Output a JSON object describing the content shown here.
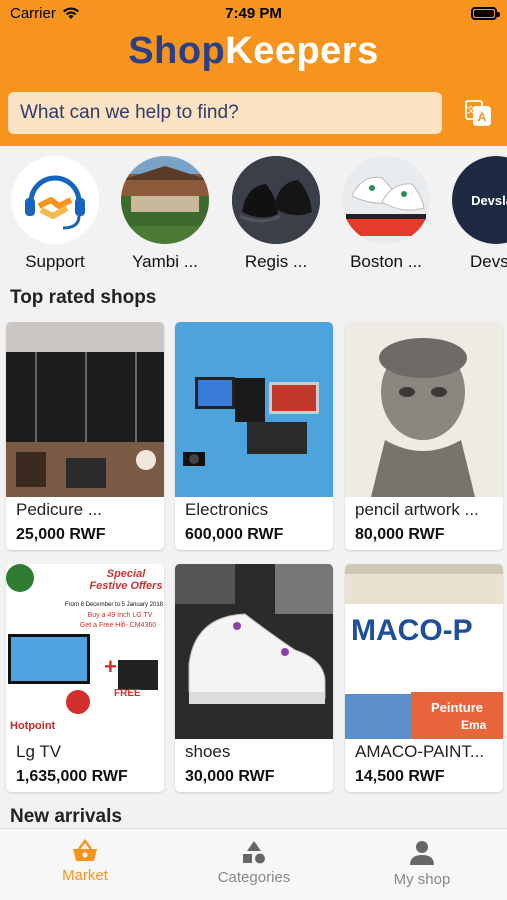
{
  "status": {
    "carrier": "Carrier",
    "time": "7:49 PM"
  },
  "brand": {
    "part1": "Shop",
    "part2": "Keepers"
  },
  "search": {
    "placeholder": "What can we help to find?"
  },
  "stories": [
    {
      "label": "Support"
    },
    {
      "label": "Yambi ..."
    },
    {
      "label": "Regis ..."
    },
    {
      "label": "Boston ..."
    },
    {
      "label": "Devsla"
    }
  ],
  "sections": {
    "top_rated": "Top rated shops",
    "new_arrivals": "New arrivals"
  },
  "products": [
    {
      "name": "Pedicure ...",
      "price": "25,000 RWF"
    },
    {
      "name": "Electronics",
      "price": "600,000 RWF"
    },
    {
      "name": "pencil artwork ...",
      "price": "80,000 RWF"
    },
    {
      "name": "Lg TV",
      "price": "1,635,000 RWF"
    },
    {
      "name": "shoes",
      "price": "30,000 RWF"
    },
    {
      "name": "AMACO-PAINT...",
      "price": "14,500 RWF"
    }
  ],
  "product_image_text": {
    "festive_title": "Special Festive Offers",
    "festive_dates": "From 8 December to 5 January 2018",
    "festive_buy": "Buy a 49 Inch LG TV",
    "festive_get": "Get a Free Hifi- CM4360",
    "festive_free": "FREE",
    "festive_brand": "Hotpoint",
    "amaco_text": "MACO-P",
    "amaco_sub": "Peinture",
    "amaco_sub2": "Ema",
    "devslab": "Devslab"
  },
  "tabs": [
    {
      "label": "Market",
      "icon": "basket-icon",
      "active": true
    },
    {
      "label": "Categories",
      "icon": "shapes-icon",
      "active": false
    },
    {
      "label": "My shop",
      "icon": "person-icon",
      "active": false
    }
  ],
  "colors": {
    "brand_orange": "#f7941d",
    "brand_navy": "#2c3e86",
    "search_bg": "#fbe3c3"
  }
}
